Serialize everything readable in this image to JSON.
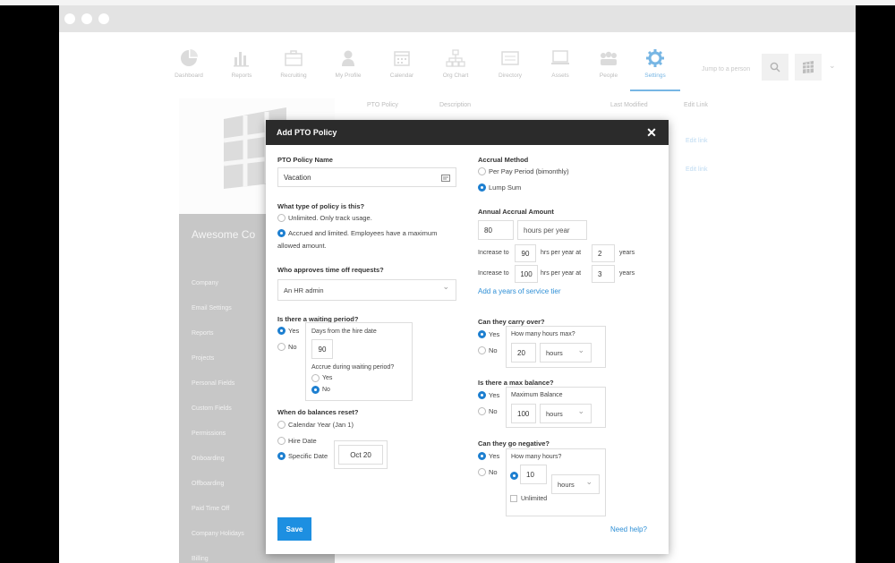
{
  "nav": [
    {
      "label": "Dashboard",
      "icon": "pie-chart-icon"
    },
    {
      "label": "Reports",
      "icon": "bar-chart-icon"
    },
    {
      "label": "Recruiting",
      "icon": "briefcase-icon"
    },
    {
      "label": "My Profile",
      "icon": "person-icon"
    },
    {
      "label": "Calendar",
      "icon": "calendar-icon"
    },
    {
      "label": "Org Chart",
      "icon": "org-chart-icon"
    },
    {
      "label": "Directory",
      "icon": "directory-icon"
    },
    {
      "label": "Assets",
      "icon": "laptop-icon"
    },
    {
      "label": "People",
      "icon": "people-icon"
    },
    {
      "label": "Settings",
      "icon": "gear-icon"
    }
  ],
  "search_placeholder": "Jump to a person",
  "background": {
    "columns": [
      "PTO Policy",
      "Description",
      "Last Modified",
      "Edit Link"
    ],
    "links": [
      "Edit link",
      "Edit link"
    ],
    "company": "Awesome Co",
    "sidebar_items": [
      "Company",
      "Email Settings",
      "Reports",
      "Projects",
      "Personal Fields",
      "Custom Fields",
      "Permissions",
      "Onboarding",
      "Offboarding",
      "Paid Time Off",
      "Company Holidays",
      "Billing"
    ]
  },
  "modal": {
    "title": "Add PTO Policy",
    "name_label": "PTO Policy Name",
    "name_value": "Vacation",
    "type_q": "What type of policy is this?",
    "type_unlimited": "Unlimited. Only track usage.",
    "type_accrued_1": "Accrued and limited. Employees have a maximum",
    "type_accrued_2": "allowed amount.",
    "approver_q": "Who approves time off requests?",
    "approver_value": "An HR admin",
    "waiting_q": "Is there a waiting period?",
    "yes": "Yes",
    "no": "No",
    "days_label": "Days from the hire date",
    "days_value": "90",
    "accrue_q": "Accrue during waiting period?",
    "reset_q": "When do balances reset?",
    "reset_calendar": "Calendar Year (Jan 1)",
    "reset_hire": "Hire Date",
    "reset_specific": "Specific Date",
    "reset_date": "Oct 20",
    "accrual_method_q": "Accrual Method",
    "accrual_per_pay": "Per Pay Period (bimonthly)",
    "accrual_lump": "Lump Sum",
    "annual_q": "Annual Accrual Amount",
    "annual_value": "80",
    "hours_per_year": "hours per year",
    "increase_to": "Increase to",
    "hrs_per_year_at": "hrs per year at",
    "years": "years",
    "inc1_hours": "90",
    "inc1_years": "2",
    "inc2_hours": "100",
    "inc2_years": "3",
    "add_tier": "Add a years of service tier",
    "carry_q": "Can they carry over?",
    "carry_label": "How many hours max?",
    "carry_value": "20",
    "unit_hours": "hours",
    "maxbal_q": "Is there a max balance?",
    "maxbal_label": "Maximum Balance",
    "maxbal_value": "100",
    "neg_q": "Can they go negative?",
    "neg_label": "How many hours?",
    "neg_value": "10",
    "unlimited": "Unlimited",
    "save": "Save",
    "help": "Need help?"
  }
}
